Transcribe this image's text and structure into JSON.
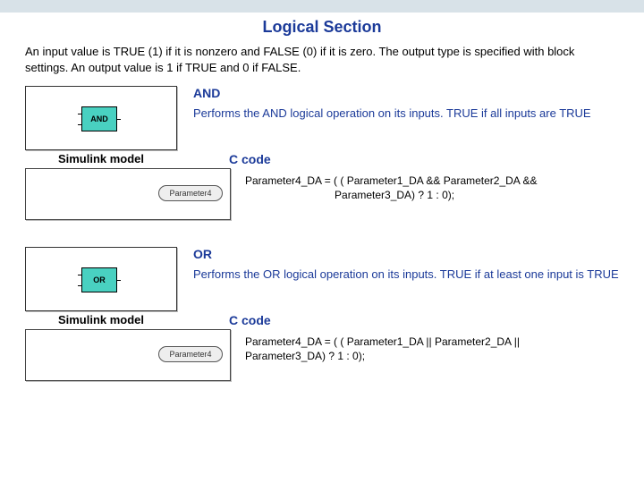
{
  "title": "Logical Section",
  "intro": "An input value is TRUE (1) if it is nonzero and FALSE (0) if it is zero. The output type is specified with block settings. An output value is 1 if TRUE and 0 if FALSE.",
  "labels": {
    "simulink": "Simulink model",
    "ccode": "C code",
    "param_pill": "Parameter4"
  },
  "ops": [
    {
      "name": "AND",
      "desc": "Performs the AND logical operation on its inputs. TRUE if all inputs are TRUE",
      "code_line1": "Parameter4_DA = ( ( Parameter1_DA && Parameter2_DA &&",
      "code_line2": "                              Parameter3_DA) ? 1 : 0);"
    },
    {
      "name": "OR",
      "desc": "Performs the OR logical operation on its inputs. TRUE if at least one input is TRUE",
      "code_line1": "Parameter4_DA = ( ( Parameter1_DA || Parameter2_DA ||",
      "code_line2": "Parameter3_DA) ? 1 : 0);"
    }
  ]
}
